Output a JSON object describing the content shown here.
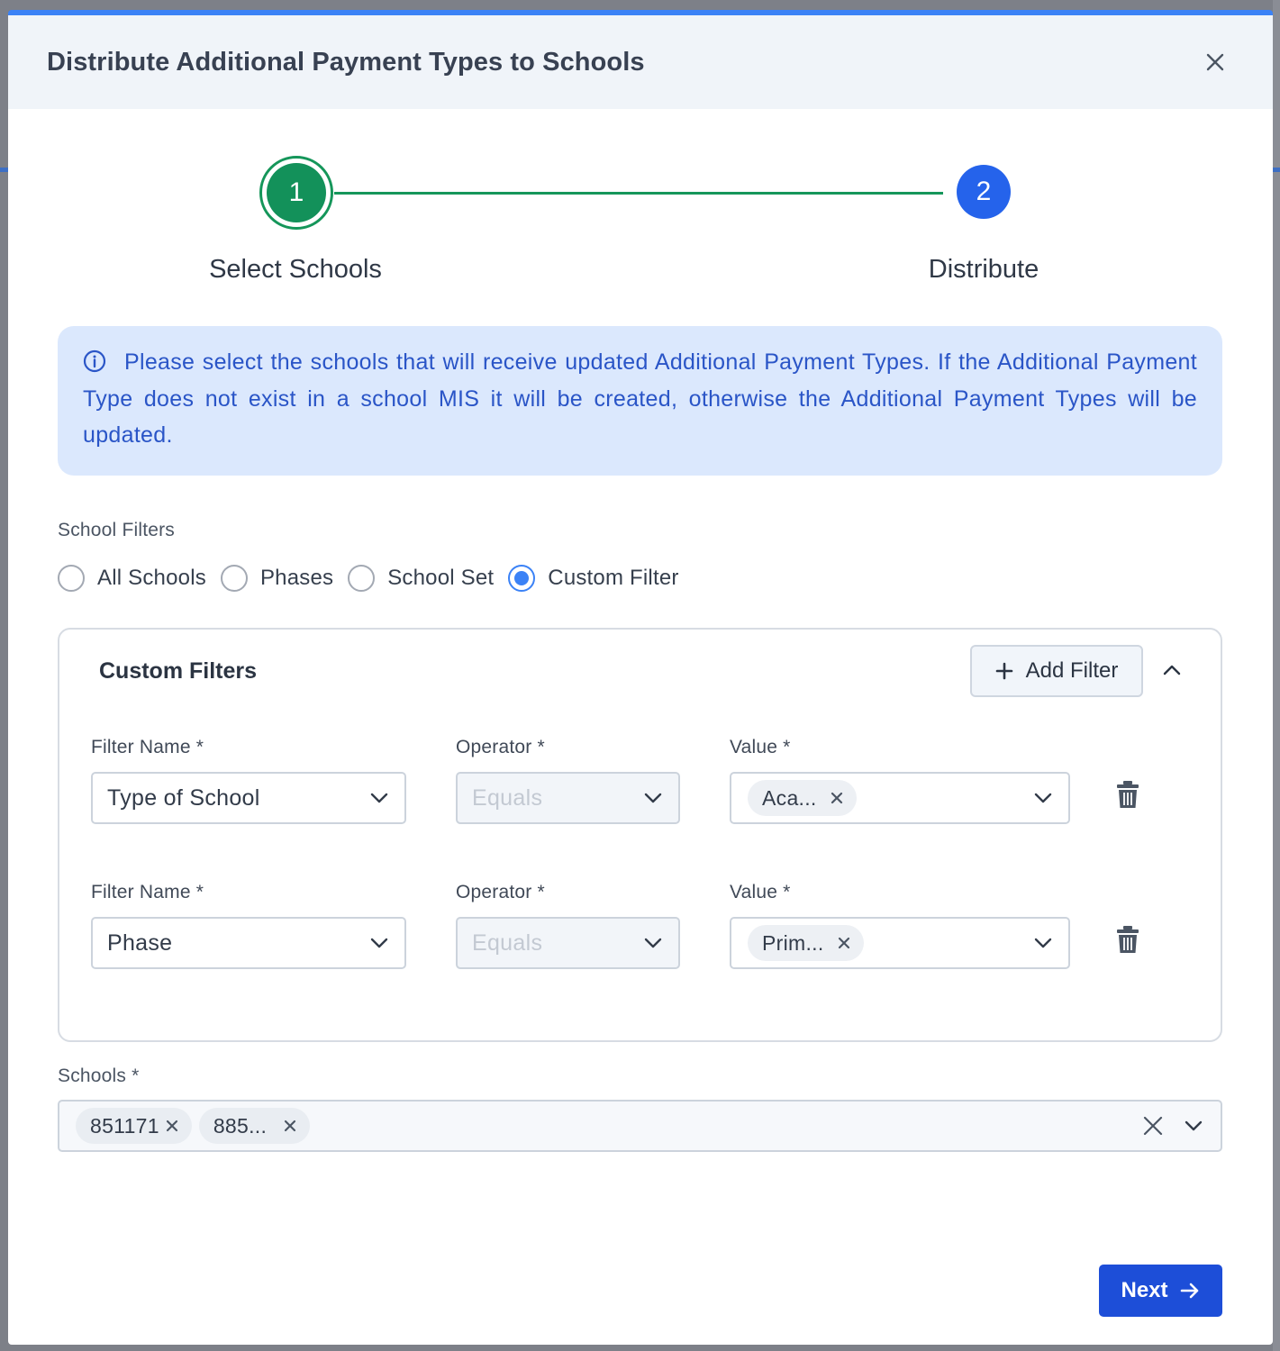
{
  "modal": {
    "title": "Distribute Additional Payment Types to Schools"
  },
  "stepper": {
    "steps": [
      {
        "number": "1",
        "label": "Select Schools",
        "status": "current"
      },
      {
        "number": "2",
        "label": "Distribute",
        "status": "pending"
      }
    ]
  },
  "info": {
    "text": "Please select the schools that will receive updated Additional Payment Types. If the Additional Payment Type does not exist in a school MIS it will be created, otherwise the Additional Payment Types will be updated."
  },
  "school_filters": {
    "label": "School Filters",
    "options": [
      {
        "label": "All Schools",
        "checked": false
      },
      {
        "label": "Phases",
        "checked": false
      },
      {
        "label": "School Set",
        "checked": false
      },
      {
        "label": "Custom Filter",
        "checked": true
      }
    ]
  },
  "custom_filters": {
    "title": "Custom Filters",
    "add_filter_label": "Add Filter",
    "rows": [
      {
        "filter_name_label": "Filter Name *",
        "filter_name_value": "Type of School",
        "operator_label": "Operator *",
        "operator_value": "Equals",
        "value_label": "Value *",
        "value_chip": "Aca..."
      },
      {
        "filter_name_label": "Filter Name *",
        "filter_name_value": "Phase",
        "operator_label": "Operator *",
        "operator_value": "Equals",
        "value_label": "Value *",
        "value_chip": "Prim..."
      }
    ]
  },
  "schools": {
    "label": "Schools *",
    "chips": [
      "851171",
      "885..."
    ]
  },
  "footer": {
    "next_label": "Next"
  },
  "colors": {
    "accent_top": "#3b82f6",
    "step_complete": "#13915a",
    "step_pending": "#2563eb",
    "info_bg": "#dbe8fd",
    "info_text": "#2a55c7",
    "primary_button": "#1d4ed8"
  }
}
